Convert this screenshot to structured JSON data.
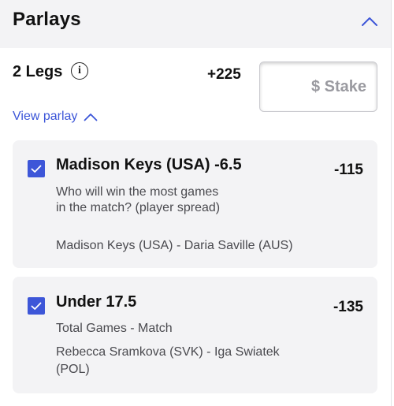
{
  "header": {
    "title": "Parlays",
    "collapse_icon": "chevron-up-icon"
  },
  "summary": {
    "legs_label": "2 Legs",
    "info_icon_glyph": "i",
    "odds": "+225",
    "stake_placeholder": "$ Stake",
    "stake_value": ""
  },
  "view_parlay": {
    "label": "View parlay",
    "icon": "chevron-up-icon",
    "expanded": true
  },
  "legs": [
    {
      "selected": true,
      "title": "Madison Keys (USA) -6.5",
      "odds": "-115",
      "market": "Who will win the most games in the match? (player spread)",
      "match": "Madison Keys (USA) - Daria Saville (AUS)"
    },
    {
      "selected": true,
      "title": "Under 17.5",
      "odds": "-135",
      "market": "Total Games - Match",
      "match": "Rebecca Sramkova (SVK) - Iga Swiatek (POL)"
    }
  ],
  "colors": {
    "accent": "#3d56d8",
    "link": "#3b55d8",
    "panel_bg": "#f3f3f5",
    "muted_text": "#4a4a4f"
  }
}
